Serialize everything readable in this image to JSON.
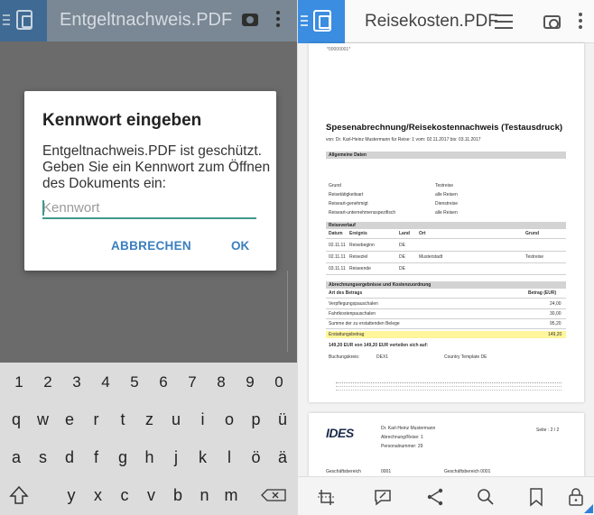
{
  "left": {
    "header": {
      "title": "Entgeltnachweis.PDF"
    },
    "dialog": {
      "title": "Kennwort eingeben",
      "message": "Entgeltnachweis.PDF ist geschützt. Geben Sie ein Kennwort zum Öffnen des Dokuments ein:",
      "input_placeholder": "Kennwort",
      "input_value": "",
      "cancel_label": "ABBRECHEN",
      "ok_label": "OK"
    },
    "keyboard": {
      "numbers": [
        "1",
        "2",
        "3",
        "4",
        "5",
        "6",
        "7",
        "8",
        "9",
        "0"
      ],
      "row1": [
        "q",
        "w",
        "e",
        "r",
        "t",
        "z",
        "u",
        "i",
        "o",
        "p",
        "ü"
      ],
      "row1_hints": [
        "",
        "",
        "",
        "",
        "",
        "",
        "",
        "",
        "",
        "",
        ""
      ],
      "row2": [
        "a",
        "s",
        "d",
        "f",
        "g",
        "h",
        "j",
        "k",
        "l",
        "ö",
        "ä"
      ],
      "row3": [
        "y",
        "x",
        "c",
        "v",
        "b",
        "n",
        "m"
      ]
    }
  },
  "right": {
    "header": {
      "title": "Reisekosten.PDF"
    },
    "document": {
      "top_mark": "*00000001*",
      "title": "Spesenabrechnung/Reisekostennachweis  (Testausdruck)",
      "subtitle": "von: Dr. Karl-Heinz Mustermann für Reise: 1 vom: 02.11.2017 bis: 03.11.2017",
      "section_general": "Allgemeine Daten",
      "general_rows": [
        {
          "label": "Grund",
          "value": "Testreise"
        },
        {
          "label": "Reisetätigkeitsart",
          "value": "alle Reisen"
        },
        {
          "label": "Reiseart-genehmigt",
          "value": "Dienstreise"
        },
        {
          "label": "Reiseart-unternehmensspezifisch",
          "value": "alle Reisen"
        }
      ],
      "section_course": "Reiseverlauf",
      "course_headers": [
        "Datum",
        "Ereignis",
        "Land",
        "Ort",
        "Grund"
      ],
      "course_rows": [
        [
          "02.11.11",
          "Reisebeginn",
          "DE",
          "",
          ""
        ],
        [
          "02.11.11",
          "Reiseziel",
          "DE",
          "Musterstadt",
          "Testreise"
        ],
        [
          "03.11.11",
          "Reiseende",
          "DE",
          "",
          ""
        ]
      ],
      "section_results": "Abrechnungsergebnisse und Kostenzuordnung",
      "results_headers": [
        "Art des Betrags",
        "Betrag (EUR)"
      ],
      "results_rows": [
        {
          "label": "Verpflegungspauschalen",
          "amount": "24,00"
        },
        {
          "label": "Fahrtkostenpauschalen",
          "amount": "30,00"
        },
        {
          "label": "Summe der zu erstattenden Belege",
          "amount": "95,20"
        }
      ],
      "refund_row": {
        "label": "Erstattungsbetrag",
        "amount": "149,20"
      },
      "summary_line": "149,20   EUR   von   149,20   EUR   verteilen sich auf:",
      "booking_label": "Buchungskreis:",
      "booking_value": "DEX1",
      "booking_country": "Country Template DE",
      "page2_logo": "IDES",
      "page2_name": "Dr. Karl-Heinz Mustermann",
      "page2_trip": "Abrechnung/Reise: 1",
      "page2_personnel": "Personalnummer: 29",
      "page2_page": "Seite :  2 / 2",
      "page2_bottom_left": "Geschäftsbereich",
      "page2_bottom_left_val": "0001",
      "page2_bottom_right": "Geschäftsbereich 0001"
    }
  }
}
